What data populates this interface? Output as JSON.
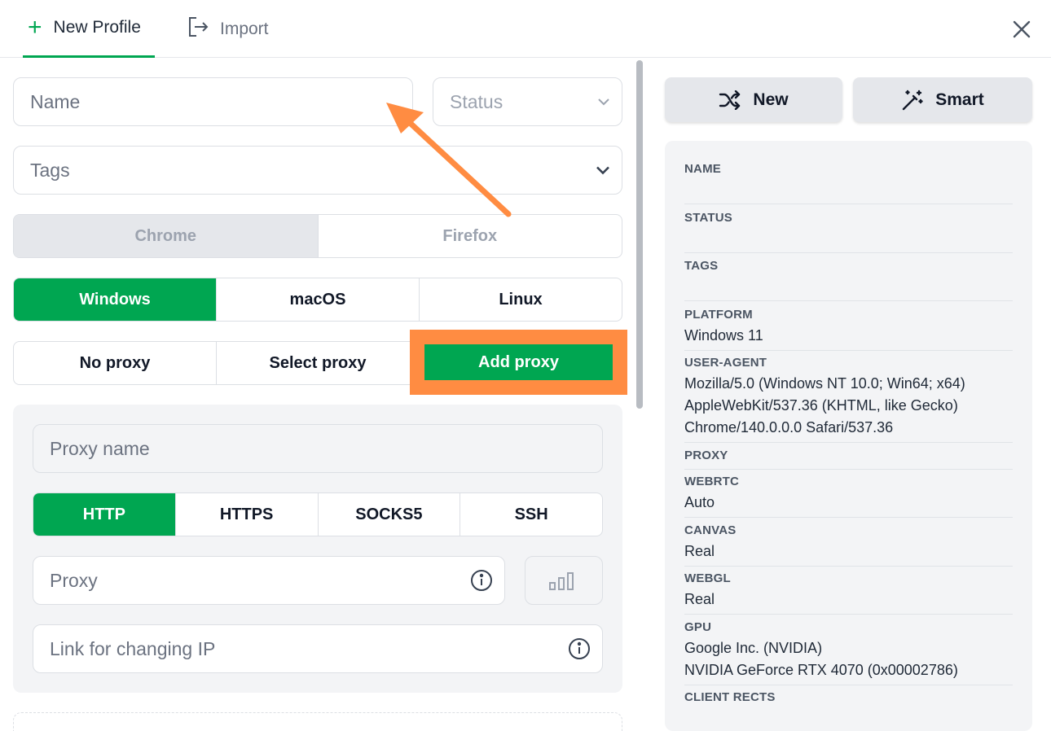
{
  "header": {
    "tab_new": "New Profile",
    "tab_import": "Import"
  },
  "form": {
    "name_placeholder": "Name",
    "status_placeholder": "Status",
    "tags_placeholder": "Tags",
    "browsers": [
      "Chrome",
      "Firefox"
    ],
    "os": [
      "Windows",
      "macOS",
      "Linux"
    ],
    "os_selected": "Windows",
    "proxy_modes": [
      "No proxy",
      "Select proxy",
      "Add proxy"
    ],
    "proxy_mode_selected": "Add proxy"
  },
  "proxy": {
    "name_placeholder": "Proxy name",
    "types": [
      "HTTP",
      "HTTPS",
      "SOCKS5",
      "SSH"
    ],
    "type_selected": "HTTP",
    "proxy_placeholder": "Proxy",
    "change_ip_placeholder": "Link for changing IP"
  },
  "right": {
    "new_label": "New",
    "smart_label": "Smart",
    "summary": {
      "name_label": "NAME",
      "status_label": "STATUS",
      "tags_label": "TAGS",
      "platform_label": "PLATFORM",
      "platform_value": "Windows 11",
      "ua_label": "USER-AGENT",
      "ua_line1": "Mozilla/5.0 (Windows NT 10.0; Win64; x64)",
      "ua_line2": "AppleWebKit/537.36 (KHTML, like Gecko)",
      "ua_line3": "Chrome/140.0.0.0 Safari/537.36",
      "proxy_label": "PROXY",
      "webrtc_label": "WEBRTC",
      "webrtc_value": "Auto",
      "canvas_label": "CANVAS",
      "canvas_value": "Real",
      "webgl_label": "WEBGL",
      "webgl_value": "Real",
      "gpu_label": "GPU",
      "gpu_line1": "Google Inc. (NVIDIA)",
      "gpu_line2": "NVIDIA GeForce RTX 4070 (0x00002786)",
      "client_rects_label": "CLIENT RECTS"
    }
  },
  "colors": {
    "accent": "#00a651",
    "highlight": "#ff8c42",
    "panel": "#f3f4f6"
  },
  "icons": [
    "plus-icon",
    "import-icon",
    "close-icon",
    "chevron-down-icon",
    "shuffle-icon",
    "magic-wand-icon",
    "info-icon",
    "signal-bars-icon",
    "annotation-arrow"
  ]
}
